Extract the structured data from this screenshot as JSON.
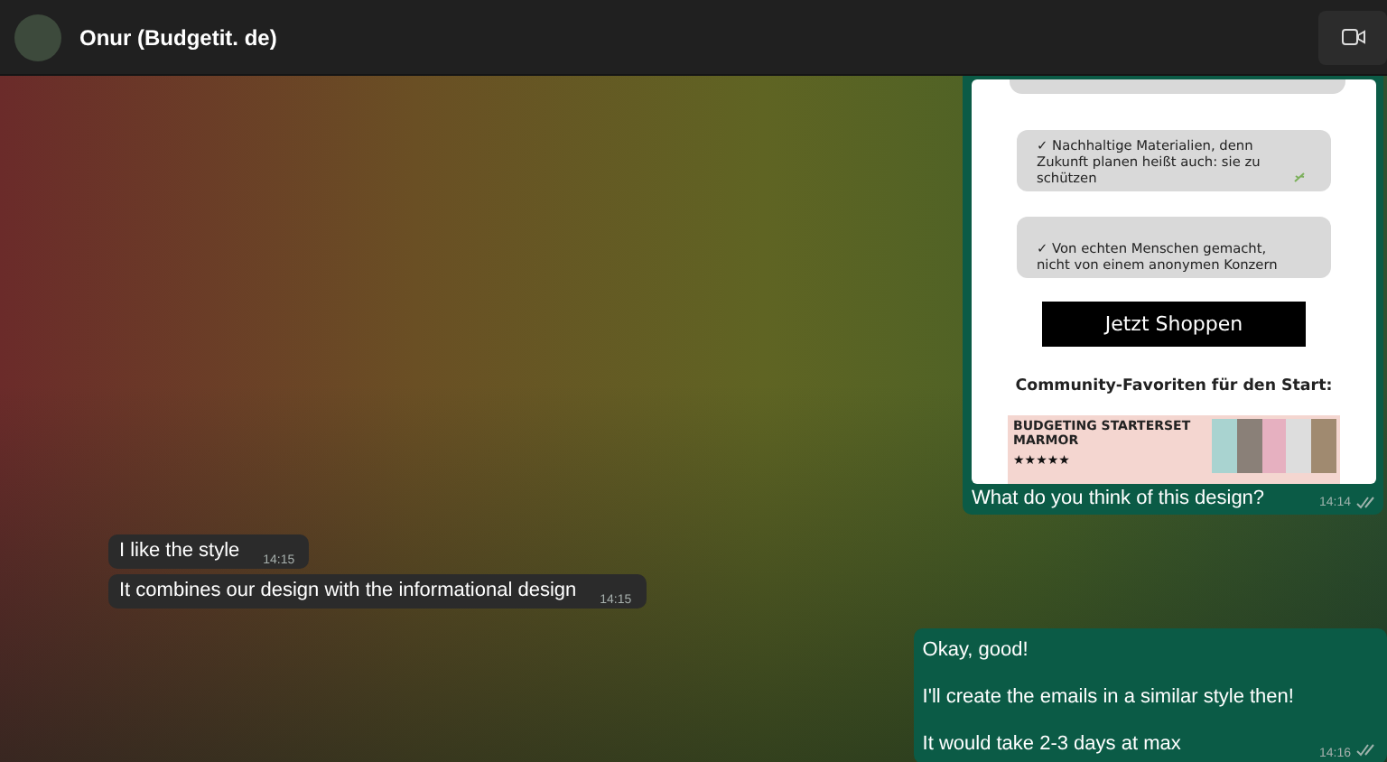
{
  "header": {
    "contact_name": "Onur (Budgetit. de)"
  },
  "messages": [
    {
      "kind": "image",
      "outgoing": true,
      "email_preview": {
        "features": [
          {
            "text": "✓ Nachhaltige Materialien, denn Zukunft planen heißt auch: sie zu schützen"
          },
          {
            "text": "✓ Von echten Menschen gemacht, nicht von einem anonymen Konzern"
          }
        ],
        "button": "Jetzt Shoppen",
        "heading": "Community-Favoriten für den Start:",
        "product": {
          "title": "BUDGETING STARTERSET MARMOR",
          "stars": 5
        }
      },
      "caption": "What do you think of this design?",
      "time": "14:14",
      "read": false
    },
    {
      "kind": "text",
      "outgoing": false,
      "lines": [
        "I like the style"
      ],
      "time": "14:15"
    },
    {
      "kind": "text",
      "outgoing": false,
      "lines": [
        "It combines our design with the informational design"
      ],
      "time": "14:15"
    },
    {
      "kind": "text",
      "outgoing": true,
      "lines": [
        "Okay, good!",
        "I'll create the emails in a similar style then!",
        "It would take 2-3 days at max"
      ],
      "time": "14:16",
      "read": false
    }
  ]
}
